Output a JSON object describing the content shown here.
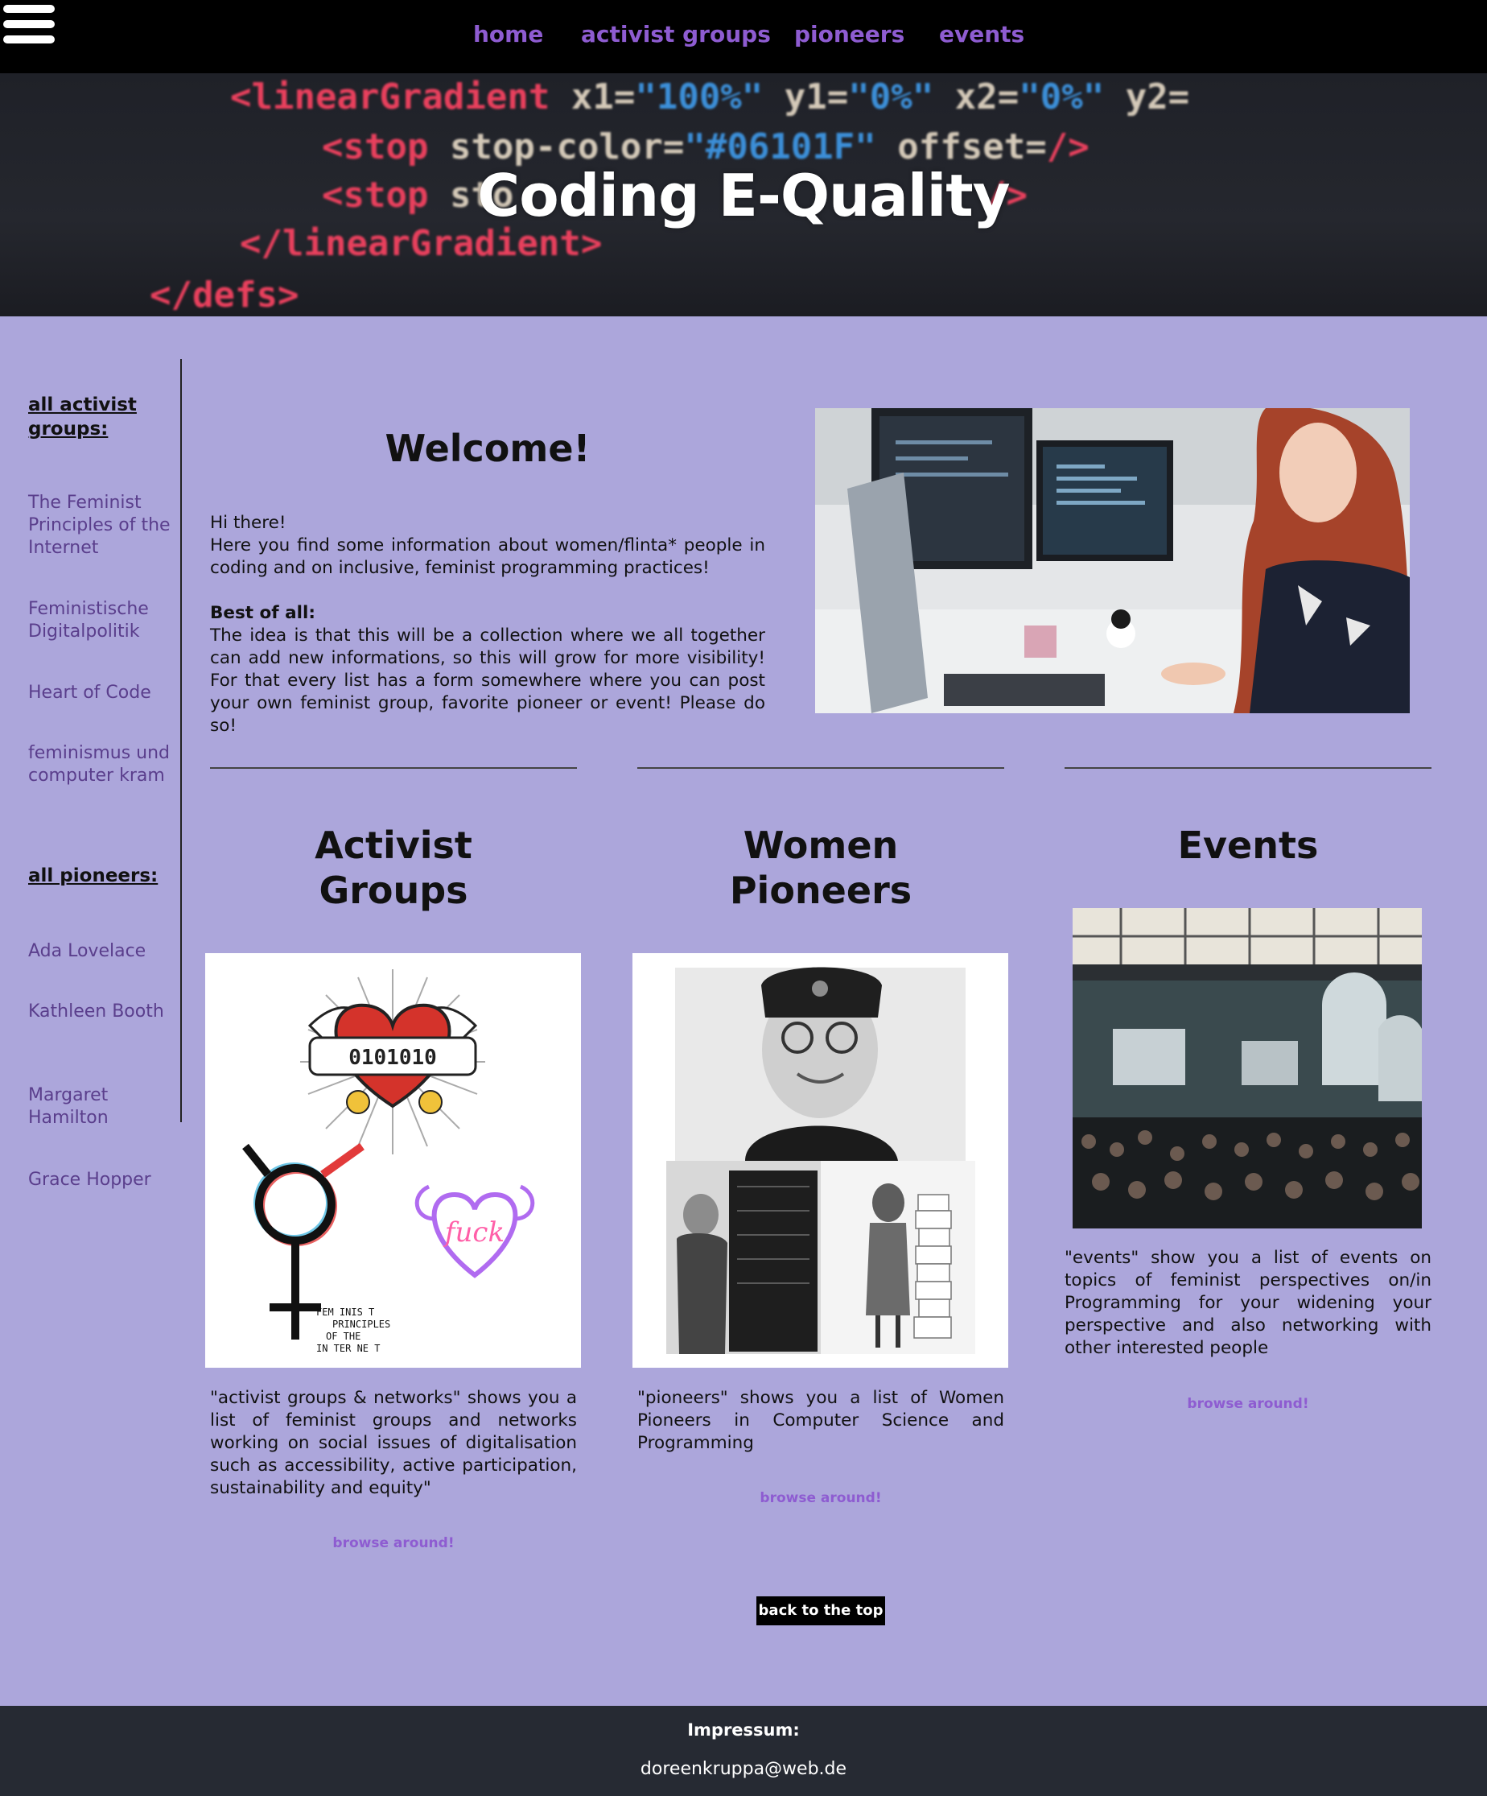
{
  "nav": {
    "menu_icon": "hamburger-icon",
    "items": [
      {
        "label": "home"
      },
      {
        "label": "activist groups"
      },
      {
        "label": "pioneers"
      },
      {
        "label": "events"
      }
    ]
  },
  "hero": {
    "title": "Coding E-Quality",
    "code": {
      "l1_tag": "<linearGradient",
      "l1_a1": "x1=",
      "l1_v1": "\"100%\"",
      "l1_a2": "y1=",
      "l1_v2": "\"0%\"",
      "l1_a3": "x2=",
      "l1_v3": "\"0%\"",
      "l1_a4": "y2=",
      "l2_tag": "<stop",
      "l2_a1": "stop-color=",
      "l2_v1": "\"#06101F\"",
      "l2_a2": "offset=",
      "l2_end": "/>",
      "l3_tag": "<stop",
      "l3_a1": "sto",
      "l3_end": "/>",
      "l4_tag": "</linearGradient>",
      "l5_tag": "</defs>"
    }
  },
  "sidebar": {
    "groups_heading": "all activist groups:",
    "groups": [
      {
        "label": "The Feminist Principles of the Internet"
      },
      {
        "label": "Feministische Digitalpolitik"
      },
      {
        "label": "Heart of Code"
      },
      {
        "label": "feminismus und computer kram"
      }
    ],
    "pioneers_heading": "all pioneers:",
    "pioneers": [
      {
        "label": "Ada Lovelace"
      },
      {
        "label": "Kathleen Booth"
      },
      {
        "label": "Margaret Hamilton"
      },
      {
        "label": "Grace Hopper"
      }
    ]
  },
  "welcome": {
    "title": "Welcome!",
    "greeting": "Hi there!",
    "intro": "Here you find some information about women/flinta* people in coding and on inclusive, feminist programming practices!",
    "best_label": "Best of all:",
    "best_text": "The idea is that this will be a collection where we all together can add new informations, so this will grow for more visibility! For that every list has a form somewhere where you can post your own feminist group, favorite pioneer or event! Please do so!"
  },
  "columns": {
    "activist": {
      "title_line1": "Activist",
      "title_line2": "Groups",
      "text": "\"activist groups & networks\" shows you a list of feminist groups and networks working on social issues of digitalisation such as accessibility, active participation, sustainability and equity\"",
      "link": "browse around!",
      "banner_text": "0101010",
      "logo_lines": [
        "FEM INIS T",
        "PRINCIPLES",
        "OF THE",
        "IN TER NE T"
      ],
      "neon_text": "fuck"
    },
    "pioneers": {
      "title_line1": "Women",
      "title_line2": "Pioneers",
      "text": "\"pioneers\" shows you a list of Women Pioneers in Computer Science and Programming",
      "link": "browse around!"
    },
    "events": {
      "title": "Events",
      "text": "\"events\" show you a list of events on topics of feminist perspectives on/in Programming for your widening your perspective and also networking with other interested people",
      "link": "browse around!"
    }
  },
  "back_to_top": "back to the top",
  "footer": {
    "impressum": "Impressum:",
    "email": "doreenkruppa@web.de"
  },
  "colors": {
    "background": "#aca6db",
    "nav_link": "#8e5cd1",
    "sidebar_link": "#5a3e8c",
    "footer": "#262a33"
  }
}
